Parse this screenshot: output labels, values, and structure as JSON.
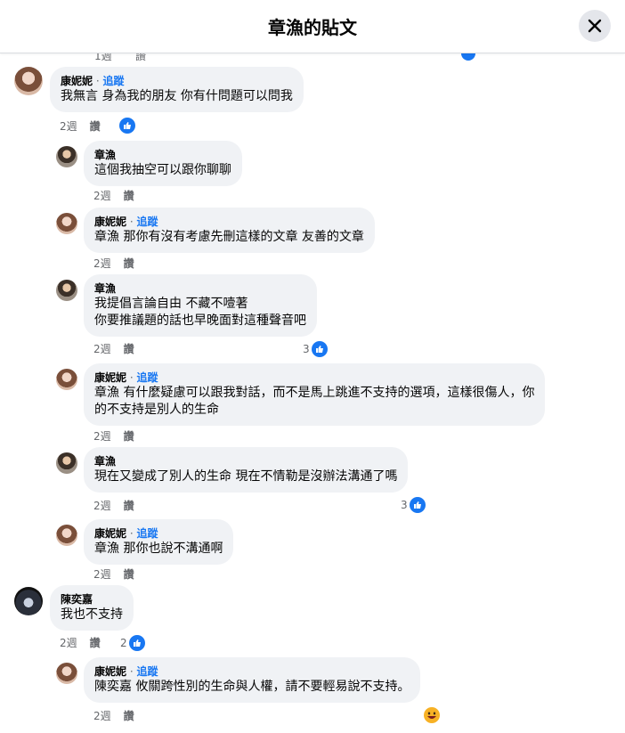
{
  "header": {
    "title": "章漁的貼文",
    "close_icon": "close-icon"
  },
  "peek": {
    "time": "1週",
    "like": "讚"
  },
  "colors": {
    "accent": "#1877f2",
    "bubble": "#f0f2f5",
    "meta": "#65676b"
  },
  "comments": [
    {
      "author": "康妮妮",
      "follow": "追蹤",
      "lines": [
        "我無言 身為我的朋友 你有什問題可以問我"
      ],
      "time": "2週",
      "like": "讚",
      "reactions": ""
    },
    {
      "author": "章漁",
      "lines": [
        "這個我抽空可以跟你聊聊"
      ],
      "time": "2週",
      "like": "讚"
    },
    {
      "author": "康妮妮",
      "follow": "追蹤",
      "lines": [
        "章漁 那你有沒有考慮先刪這樣的文章 友善的文章"
      ],
      "time": "2週",
      "like": "讚"
    },
    {
      "author": "章漁",
      "lines": [
        "我提倡言論自由 不藏不噎著",
        "你要推議題的話也早晚面對這種聲音吧"
      ],
      "time": "2週",
      "like": "讚",
      "reactions": "3"
    },
    {
      "author": "康妮妮",
      "follow": "追蹤",
      "lines": [
        "章漁 有什麼疑慮可以跟我對話，而不是馬上跳進不支持的選項，這樣很傷人，你",
        "的不支持是別人的生命"
      ],
      "time": "2週",
      "like": "讚"
    },
    {
      "author": "章漁",
      "lines": [
        "現在又變成了別人的生命 現在不情勒是沒辦法溝通了嗎"
      ],
      "time": "2週",
      "like": "讚",
      "reactions": "3"
    },
    {
      "author": "康妮妮",
      "follow": "追蹤",
      "lines": [
        "章漁 那你也說不溝通啊"
      ],
      "time": "2週",
      "like": "讚"
    },
    {
      "author": "陳奕嘉",
      "lines": [
        "我也不支持"
      ],
      "time": "2週",
      "like": "讚",
      "reactions": "2"
    },
    {
      "author": "康妮妮",
      "follow": "追蹤",
      "lines": [
        "陳奕嘉 攸關跨性別的生命與人權，請不要輕易說不支持。"
      ],
      "time": "2週",
      "like": "讚"
    }
  ]
}
